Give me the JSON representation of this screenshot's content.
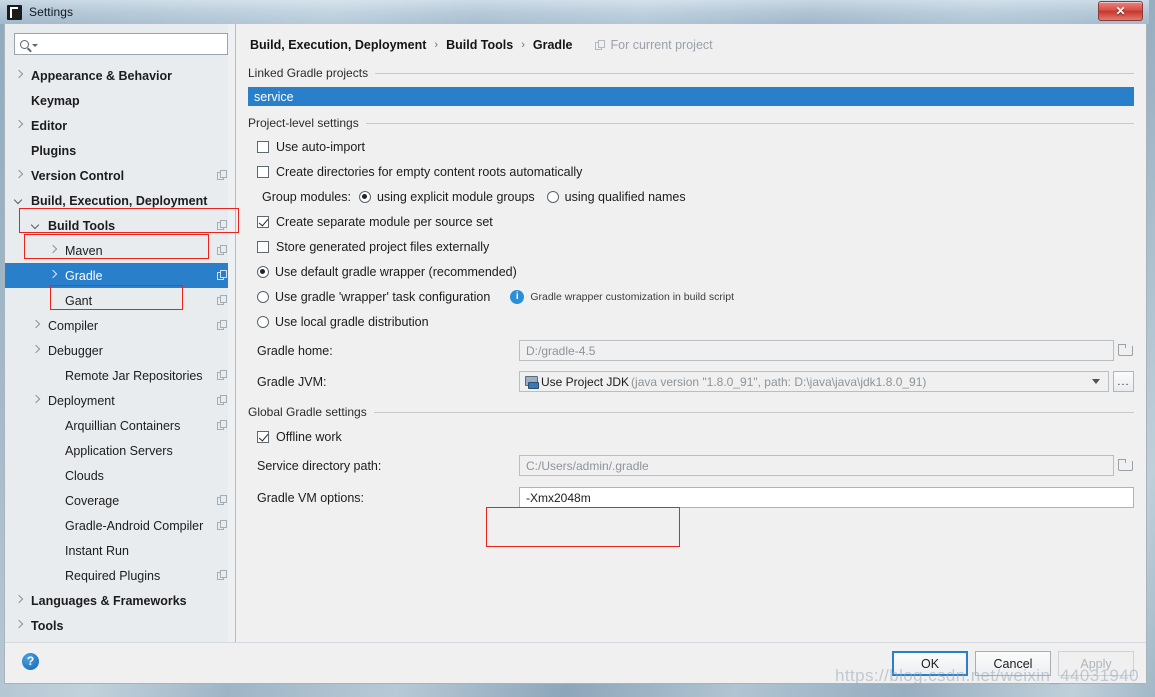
{
  "window": {
    "title": "Settings",
    "logo_icon": "intellij-idea-logo",
    "close_label": "✕",
    "accent_color": "#2a7fcb",
    "annotation_color": "#e8241d"
  },
  "search": {
    "placeholder": "",
    "value": "",
    "icon": "search-icon",
    "caret_icon": "chevron-down-icon"
  },
  "sidebar": {
    "items": [
      {
        "label": "Appearance & Behavior",
        "indent": 0,
        "arrow": "right",
        "bold": true,
        "copy": false,
        "selected": false
      },
      {
        "label": "Keymap",
        "indent": 0,
        "arrow": "none",
        "bold": true,
        "copy": false,
        "selected": false
      },
      {
        "label": "Editor",
        "indent": 0,
        "arrow": "right",
        "bold": true,
        "copy": false,
        "selected": false
      },
      {
        "label": "Plugins",
        "indent": 0,
        "arrow": "none",
        "bold": true,
        "copy": false,
        "selected": false
      },
      {
        "label": "Version Control",
        "indent": 0,
        "arrow": "right",
        "bold": true,
        "copy": true,
        "selected": false
      },
      {
        "label": "Build, Execution, Deployment",
        "indent": 0,
        "arrow": "down",
        "bold": true,
        "copy": false,
        "selected": false
      },
      {
        "label": "Build Tools",
        "indent": 1,
        "arrow": "down",
        "bold": true,
        "copy": true,
        "selected": false
      },
      {
        "label": "Maven",
        "indent": 2,
        "arrow": "right",
        "bold": false,
        "copy": true,
        "selected": false
      },
      {
        "label": "Gradle",
        "indent": 2,
        "arrow": "right",
        "bold": false,
        "copy": true,
        "selected": true
      },
      {
        "label": "Gant",
        "indent": 2,
        "arrow": "none",
        "bold": false,
        "copy": true,
        "selected": false
      },
      {
        "label": "Compiler",
        "indent": 1,
        "arrow": "right",
        "bold": false,
        "copy": true,
        "selected": false
      },
      {
        "label": "Debugger",
        "indent": 1,
        "arrow": "right",
        "bold": false,
        "copy": false,
        "selected": false
      },
      {
        "label": "Remote Jar Repositories",
        "indent": 2,
        "arrow": "none",
        "bold": false,
        "copy": true,
        "selected": false
      },
      {
        "label": "Deployment",
        "indent": 1,
        "arrow": "right",
        "bold": false,
        "copy": true,
        "selected": false
      },
      {
        "label": "Arquillian Containers",
        "indent": 2,
        "arrow": "none",
        "bold": false,
        "copy": true,
        "selected": false
      },
      {
        "label": "Application Servers",
        "indent": 2,
        "arrow": "none",
        "bold": false,
        "copy": false,
        "selected": false
      },
      {
        "label": "Clouds",
        "indent": 2,
        "arrow": "none",
        "bold": false,
        "copy": false,
        "selected": false
      },
      {
        "label": "Coverage",
        "indent": 2,
        "arrow": "none",
        "bold": false,
        "copy": true,
        "selected": false
      },
      {
        "label": "Gradle-Android Compiler",
        "indent": 2,
        "arrow": "none",
        "bold": false,
        "copy": true,
        "selected": false
      },
      {
        "label": "Instant Run",
        "indent": 2,
        "arrow": "none",
        "bold": false,
        "copy": false,
        "selected": false
      },
      {
        "label": "Required Plugins",
        "indent": 2,
        "arrow": "none",
        "bold": false,
        "copy": true,
        "selected": false
      },
      {
        "label": "Languages & Frameworks",
        "indent": 0,
        "arrow": "right",
        "bold": true,
        "copy": false,
        "selected": false
      },
      {
        "label": "Tools",
        "indent": 0,
        "arrow": "right",
        "bold": true,
        "copy": false,
        "selected": false
      }
    ]
  },
  "breadcrumb": {
    "crumb1": "Build, Execution, Deployment",
    "sep1": "›",
    "crumb2": "Build Tools",
    "sep2": "›",
    "crumb3": "Gradle",
    "scope_label": "For current project",
    "scope_icon": "project-scope-icon"
  },
  "linked_projects": {
    "group_label": "Linked Gradle projects",
    "selected_item": "service"
  },
  "project_settings": {
    "group_label": "Project-level settings",
    "use_auto_import": {
      "label": "Use auto-import",
      "checked": false
    },
    "create_dirs": {
      "label": "Create directories for empty content roots automatically",
      "checked": false
    },
    "group_modules": {
      "label": "Group modules:",
      "options": [
        {
          "label": "using explicit module groups",
          "selected": true
        },
        {
          "label": "using qualified names",
          "selected": false
        }
      ]
    },
    "separate_module": {
      "label": "Create separate module per source set",
      "checked": true
    },
    "store_external": {
      "label": "Store generated project files externally",
      "checked": false
    },
    "distribution": {
      "options": [
        {
          "label": "Use default gradle wrapper (recommended)",
          "selected": true
        },
        {
          "label": "Use gradle 'wrapper' task configuration",
          "selected": false
        },
        {
          "label": "Use local gradle distribution",
          "selected": false
        }
      ],
      "hint_icon": "info-icon",
      "hint_text": "Gradle wrapper customization in build script"
    },
    "gradle_home": {
      "label": "Gradle home:",
      "value": "D:/gradle-4.5",
      "browse_icon": "folder-browse-icon"
    },
    "gradle_jvm": {
      "label": "Gradle JVM:",
      "value_main": "Use Project JDK",
      "value_sub": "(java version \"1.8.0_91\", path: D:\\java\\java\\jdk1.8.0_91)",
      "jdk_icon": "jdk-icon",
      "caret_icon": "chevron-down-icon",
      "ellipsis_label": "..."
    }
  },
  "global_settings": {
    "group_label": "Global Gradle settings",
    "offline_work": {
      "label": "Offline work",
      "checked": true
    },
    "service_dir": {
      "label": "Service directory path:",
      "value": "C:/Users/admin/.gradle",
      "browse_icon": "folder-browse-icon"
    },
    "vm_options": {
      "label": "Gradle VM options:",
      "value": "-Xmx2048m"
    }
  },
  "footer": {
    "help_label": "?",
    "ok_label": "OK",
    "cancel_label": "Cancel",
    "apply_label": "Apply"
  },
  "watermark": "https://blog.csdn.net/weixin_44031940"
}
